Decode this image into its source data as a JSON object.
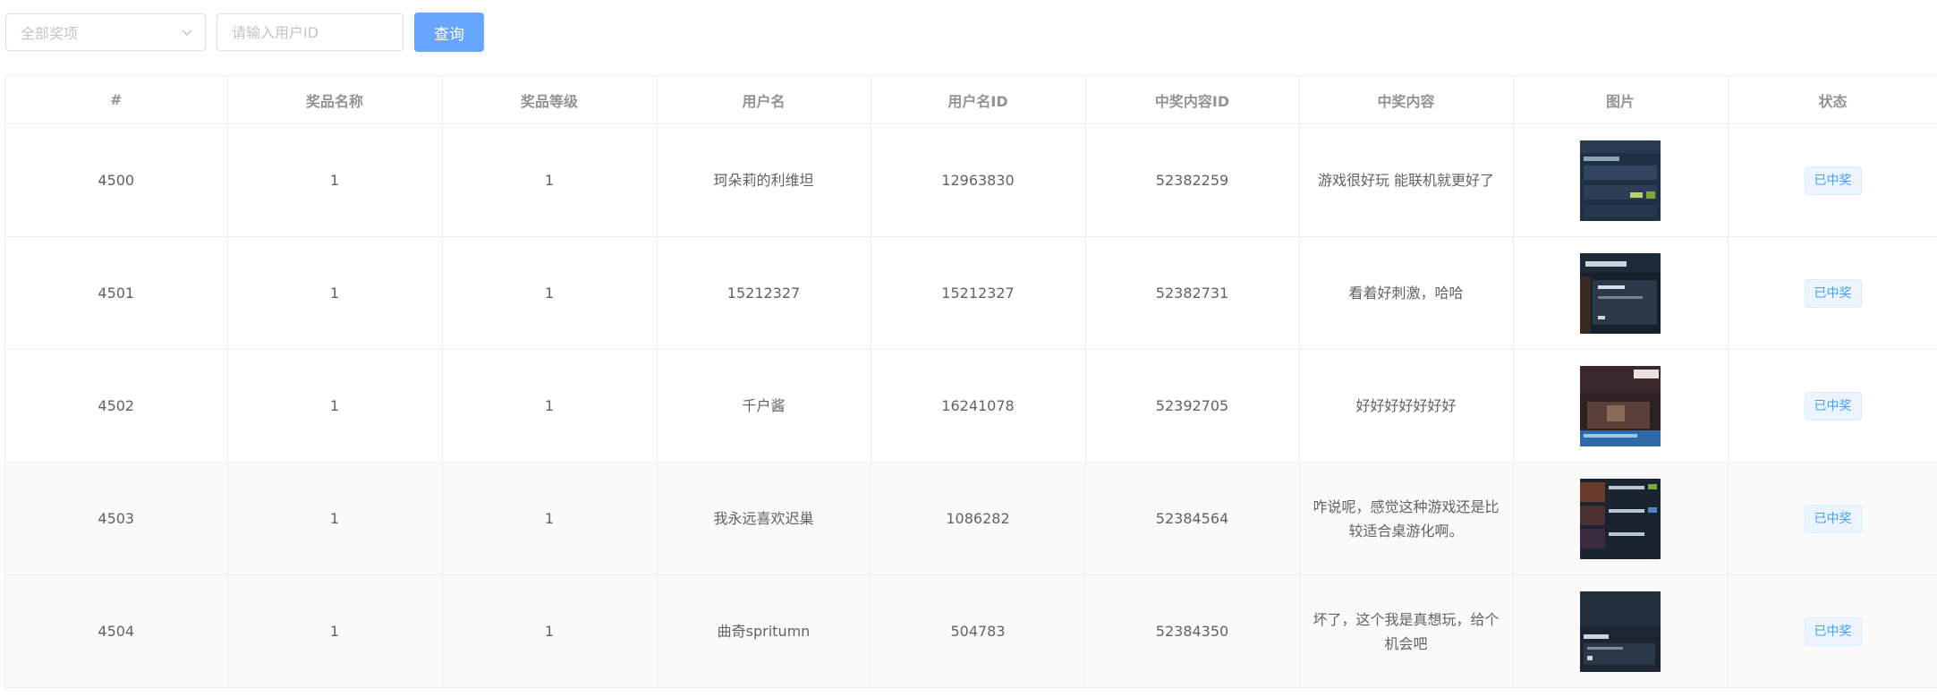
{
  "filters": {
    "prize_select": {
      "value": "全部奖项"
    },
    "user_id_input": {
      "placeholder": "请输入用户ID",
      "value": ""
    },
    "query_button": "查询"
  },
  "table": {
    "headers": [
      "#",
      "奖品名称",
      "奖品等级",
      "用户名",
      "用户名ID",
      "中奖内容ID",
      "中奖内容",
      "图片",
      "状态"
    ],
    "rows": [
      {
        "index": "4500",
        "prize_name": "1",
        "prize_level": "1",
        "username": "珂朵莉的利维坦",
        "user_id": "12963830",
        "content_id": "52382259",
        "content": "游戏很好玩 能联机就更好了",
        "image": "game-screenshot-thumbnail",
        "status": "已中奖"
      },
      {
        "index": "4501",
        "prize_name": "1",
        "prize_level": "1",
        "username": "15212327",
        "user_id": "15212327",
        "content_id": "52382731",
        "content": "看着好刺激，哈哈",
        "image": "game-screenshot-thumbnail",
        "status": "已中奖"
      },
      {
        "index": "4502",
        "prize_name": "1",
        "prize_level": "1",
        "username": "千户酱",
        "user_id": "16241078",
        "content_id": "52392705",
        "content": "好好好好好好好",
        "image": "game-screenshot-thumbnail",
        "status": "已中奖"
      },
      {
        "index": "4503",
        "prize_name": "1",
        "prize_level": "1",
        "username": "我永远喜欢迟巢",
        "user_id": "1086282",
        "content_id": "52384564",
        "content": "咋说呢，感觉这种游戏还是比较适合桌游化啊。",
        "image": "game-screenshot-thumbnail",
        "status": "已中奖"
      },
      {
        "index": "4504",
        "prize_name": "1",
        "prize_level": "1",
        "username": "曲奇spritumn",
        "user_id": "504783",
        "content_id": "52384350",
        "content": "坏了，这个我是真想玩，给个机会吧",
        "image": "game-screenshot-thumbnail",
        "status": "已中奖"
      }
    ]
  },
  "colors": {
    "primary_button": "#66a6ff",
    "tag_text": "#409eff",
    "tag_bg": "#ecf5ff",
    "border": "#ebeef5"
  }
}
